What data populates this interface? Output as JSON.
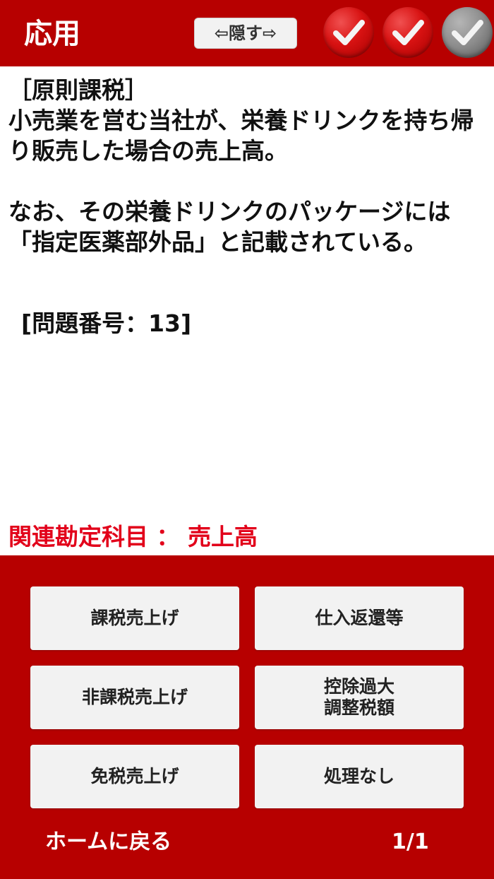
{
  "header": {
    "title": "応用",
    "hide_button": "⇦隠す⇨",
    "checks": [
      {
        "state": "red",
        "icon": "check-icon"
      },
      {
        "state": "red",
        "icon": "check-icon"
      },
      {
        "state": "gray",
        "icon": "check-icon"
      }
    ]
  },
  "question": {
    "text": "［原則課税］\n小売業を営む当社が、栄養ドリンクを持ち帰り販売した場合の売上高。\n\nなお、その栄養ドリンクのパッケージには「指定医薬部外品」と記載されている。",
    "number": "[問題番号：13]",
    "related_account": "関連勘定科目 ： 売上高"
  },
  "answers": [
    "課税売上げ",
    "仕入返還等",
    "非課税売上げ",
    "控除過大\n調整税額",
    "免税売上げ",
    "処理なし"
  ],
  "footer": {
    "home_label": "ホームに戻る",
    "page_indicator": "1/1"
  },
  "colors": {
    "brand_red": "#b70000",
    "related_red": "#e2001a"
  }
}
